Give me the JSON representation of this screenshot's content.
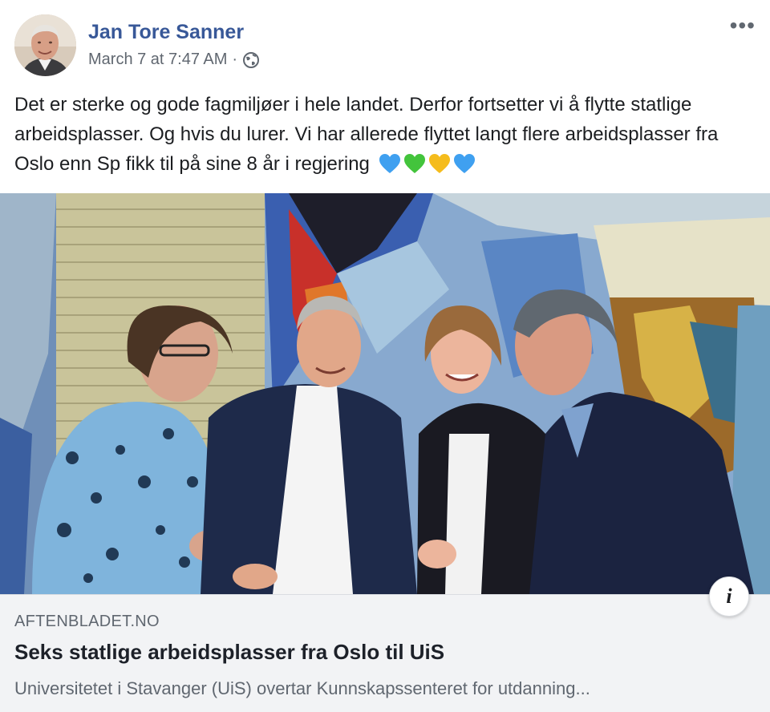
{
  "post": {
    "author": "Jan Tore Sanner",
    "timestamp": "March 7 at 7:47 AM",
    "separator": "·",
    "privacy_icon": "globe-icon",
    "more_icon": "more-options-icon",
    "more_label": "•••",
    "text": "Det er sterke og gode fagmiljøer i hele landet. Derfor fortsetter vi å flytte statlige arbeidsplasser. Og hvis du lurer. Vi har allerede flyttet langt flere arbeidsplasser fra Oslo enn Sp fikk til på sine 8 år i regjering",
    "emojis": [
      {
        "name": "blue-heart-emoji",
        "color": "#3fa0f0"
      },
      {
        "name": "green-heart-emoji",
        "color": "#43c43c"
      },
      {
        "name": "yellow-heart-emoji",
        "color": "#f5bc1c"
      },
      {
        "name": "blue-heart-emoji",
        "color": "#3fa0f0"
      }
    ]
  },
  "link_preview": {
    "domain": "AFTENBLADET.NO",
    "title": "Seks statlige arbeidsplasser fra Oslo til UiS",
    "description": "Universitetet i Stavanger (UiS) overtar Kunnskapssenteret for utdanning...",
    "info_label": "i",
    "info_icon": "info-icon"
  },
  "colors": {
    "author_link": "#385898",
    "secondary_text": "#606770",
    "link_background": "#f2f3f5"
  }
}
